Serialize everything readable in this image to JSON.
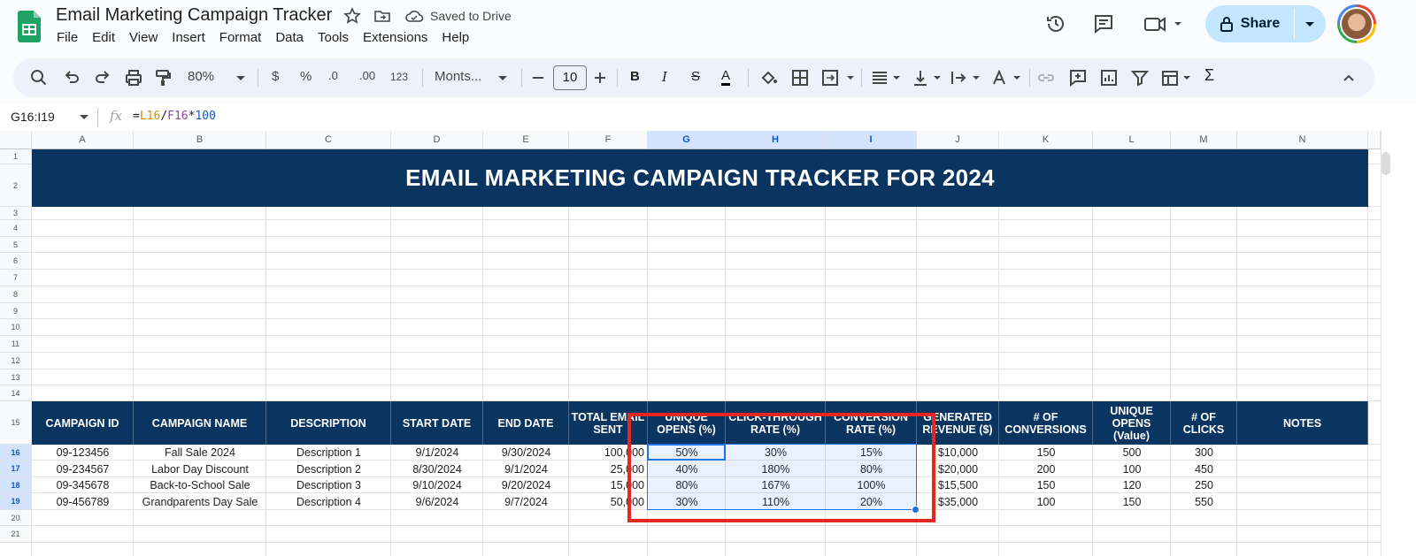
{
  "app": {
    "doc_title": "Email Marketing Campaign Tracker",
    "saved_status": "Saved to Drive",
    "share_label": "Share"
  },
  "menu": [
    "File",
    "Edit",
    "View",
    "Insert",
    "Format",
    "Data",
    "Tools",
    "Extensions",
    "Help"
  ],
  "toolbar": {
    "zoom": "80%",
    "currency": "$",
    "percent": "%",
    "dec_decrease": ".0",
    "dec_increase": ".00",
    "number_format": "123",
    "font": "Monts...",
    "font_size": "10",
    "bold": "B",
    "italic": "I",
    "strike": "S",
    "text_color": "A",
    "sum": "Σ"
  },
  "formula_bar": {
    "name_box": "G16:I19",
    "fx": "fx",
    "formula_eq": "=",
    "formula_ref1": "L16",
    "formula_div": "/",
    "formula_ref2": "F16",
    "formula_mul": "*",
    "formula_num": "100"
  },
  "columns": [
    "A",
    "B",
    "C",
    "D",
    "E",
    "F",
    "G",
    "H",
    "I",
    "J",
    "K",
    "L",
    "M",
    "N"
  ],
  "selected_columns": [
    "G",
    "H",
    "I"
  ],
  "rows": [
    "1",
    "2",
    "3",
    "4",
    "5",
    "6",
    "7",
    "8",
    "9",
    "10",
    "11",
    "12",
    "13",
    "14",
    "15",
    "16",
    "17",
    "18",
    "19",
    "20",
    "21"
  ],
  "selected_rows": [
    "16",
    "17",
    "18",
    "19"
  ],
  "sheet": {
    "banner": "EMAIL MARKETING CAMPAIGN TRACKER FOR 2024",
    "headers": [
      "CAMPAIGN ID",
      "CAMPAIGN NAME",
      "DESCRIPTION",
      "START DATE",
      "END DATE",
      "TOTAL EMAIL SENT",
      "UNIQUE OPENS (%)",
      "CLICK-THROUGH RATE (%)",
      "CONVERSION RATE (%)",
      "GENERATED REVENUE ($)",
      "# OF CONVERSIONS",
      "UNIQUE OPENS (Value)",
      "# OF CLICKS",
      "NOTES"
    ],
    "data_rows": [
      [
        "09-123456",
        "Fall Sale 2024",
        "Description 1",
        "9/1/2024",
        "9/30/2024",
        "100,000",
        "50%",
        "30%",
        "15%",
        "$10,000",
        "150",
        "500",
        "300",
        ""
      ],
      [
        "09-234567",
        "Labor Day Discount",
        "Description 2",
        "8/30/2024",
        "9/1/2024",
        "25,000",
        "40%",
        "180%",
        "80%",
        "$20,000",
        "200",
        "100",
        "450",
        ""
      ],
      [
        "09-345678",
        "Back-to-School Sale",
        "Description 3",
        "9/10/2024",
        "9/20/2024",
        "15,000",
        "80%",
        "167%",
        "100%",
        "$15,500",
        "150",
        "120",
        "250",
        ""
      ],
      [
        "09-456789",
        "Grandparents Day Sale",
        "Description 4",
        "9/6/2024",
        "9/7/2024",
        "50,000",
        "30%",
        "110%",
        "20%",
        "$35,000",
        "100",
        "150",
        "550",
        ""
      ]
    ]
  },
  "colors": {
    "header_bg": "#0b3561",
    "selection": "#1a73e8",
    "annotation": "#e6261f",
    "share_bg": "#c2e7ff"
  }
}
